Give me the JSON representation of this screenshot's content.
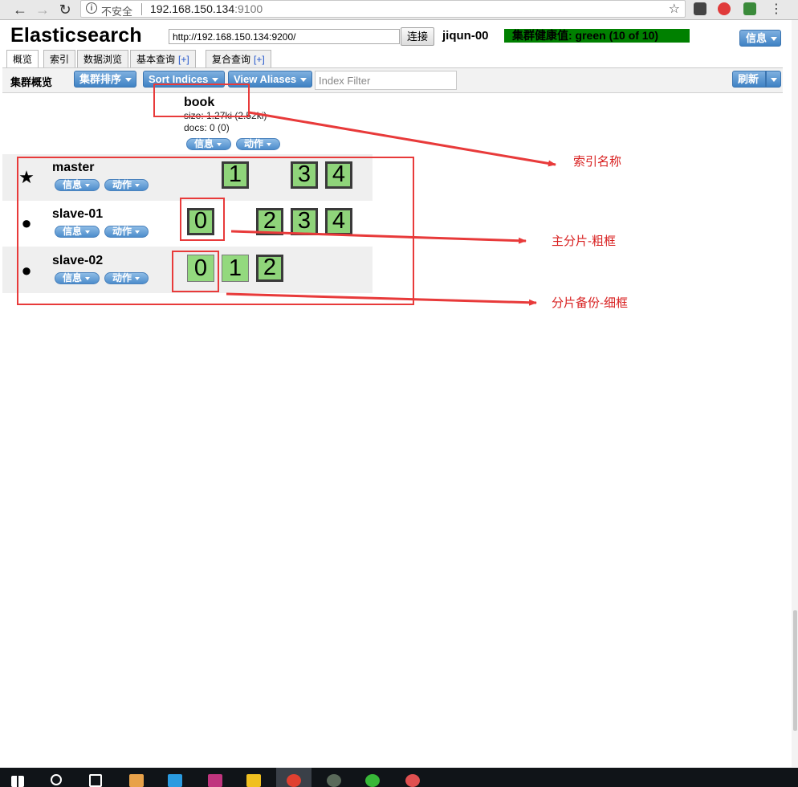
{
  "browser": {
    "insecure_label": "不安全",
    "url_host": "192.168.150.134",
    "url_port": ":9100",
    "back_icon": "arrow-left-icon",
    "forward_icon": "arrow-right-icon",
    "reload_icon": "reload-icon",
    "bookmark_icon": "star-icon"
  },
  "header": {
    "title": "Elasticsearch",
    "connect_url": "http://192.168.150.134:9200/",
    "connect_button": "连接",
    "cluster_name": "jiqun-00",
    "health": "集群健康值: green (10 of 10)",
    "info_button": "信息",
    "health_color": "#008000"
  },
  "tabs": [
    {
      "label": "概览",
      "plus": ""
    },
    {
      "label": "索引",
      "plus": ""
    },
    {
      "label": "数据浏览",
      "plus": ""
    },
    {
      "label": "基本查询",
      "plus": "[+]"
    },
    {
      "label": "复合查询",
      "plus": "[+]"
    }
  ],
  "toolbar": {
    "label": "集群概览",
    "sort_cluster": "集群排序",
    "sort_indices": "Sort Indices",
    "view_aliases": "View Aliases",
    "index_filter_placeholder": "Index Filter",
    "refresh": "刷新"
  },
  "index": {
    "name": "book",
    "size": "size: 1.27ki (2.52ki)",
    "docs": "docs: 0 (0)",
    "info": "信息",
    "action": "动作"
  },
  "nodes": [
    {
      "name": "master",
      "marker": "★",
      "info": "信息",
      "action": "动作",
      "shards": [
        {
          "n": "1",
          "primary": true
        },
        {
          "n": "3",
          "primary": true
        },
        {
          "n": "4",
          "primary": true
        }
      ]
    },
    {
      "name": "slave-01",
      "marker": "●",
      "info": "信息",
      "action": "动作",
      "shards": [
        {
          "n": "0",
          "primary": true
        },
        {
          "n": "2",
          "primary": true
        },
        {
          "n": "3",
          "primary": true
        },
        {
          "n": "4",
          "primary": true
        }
      ]
    },
    {
      "name": "slave-02",
      "marker": "●",
      "info": "信息",
      "action": "动作",
      "shards": [
        {
          "n": "0",
          "primary": false
        },
        {
          "n": "1",
          "primary": false
        },
        {
          "n": "2",
          "primary": true
        }
      ]
    }
  ],
  "annotations": {
    "index_name": "索引名称",
    "primary_shard": "主分片-粗框",
    "replica_shard": "分片备份-细框",
    "color": "#e83a3a"
  }
}
